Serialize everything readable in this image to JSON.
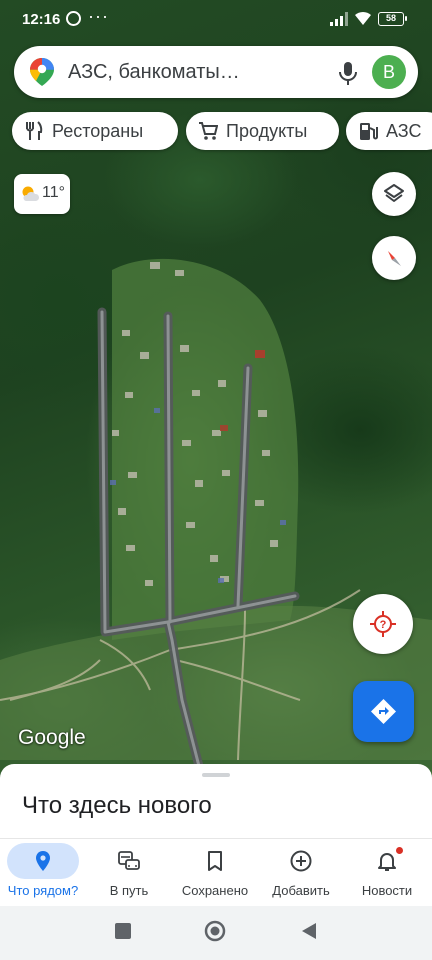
{
  "status_bar": {
    "time": "12:16",
    "more": "···",
    "battery": "58"
  },
  "search": {
    "placeholder": "АЗС, банкоматы…",
    "avatar_letter": "B"
  },
  "chips": [
    {
      "label": "Рестораны",
      "icon": "restaurant-icon"
    },
    {
      "label": "Продукты",
      "icon": "cart-icon"
    },
    {
      "label": "АЗС",
      "icon": "gas-station-icon"
    }
  ],
  "weather": {
    "temperature": "11°",
    "icon": "partly-cloudy-icon"
  },
  "map": {
    "attribution": "Google",
    "type": "satellite"
  },
  "sheet": {
    "title": "Что здесь нового"
  },
  "bottom_nav": [
    {
      "label": "Что рядом?",
      "icon": "location-pin-icon",
      "active": true
    },
    {
      "label": "В путь",
      "icon": "commute-icon",
      "active": false
    },
    {
      "label": "Сохранено",
      "icon": "bookmark-icon",
      "active": false
    },
    {
      "label": "Добавить",
      "icon": "add-circle-icon",
      "active": false
    },
    {
      "label": "Новости",
      "icon": "bell-icon",
      "active": false
    }
  ],
  "colors": {
    "accent": "#1a73e8",
    "active_pill": "#d2e3fc",
    "avatar": "#4caf50",
    "badge": "#d93025"
  }
}
